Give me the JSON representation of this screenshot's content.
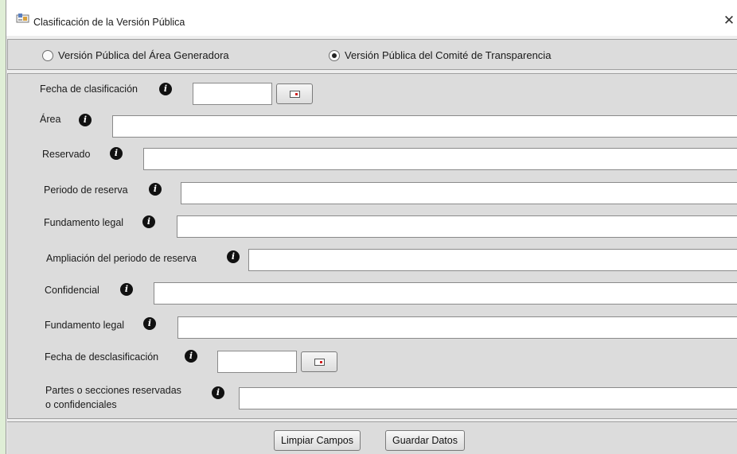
{
  "window": {
    "title": "Clasificación de la Versión Pública",
    "close_glyph": "✕",
    "app_icon": "app-icon"
  },
  "radios": [
    {
      "label": "Versión Pública del Área Generadora",
      "checked": false
    },
    {
      "label": "Versión Pública del Comité de Transparencia",
      "checked": true
    }
  ],
  "form": {
    "info_glyph": "i",
    "fecha_clasificacion": {
      "label": "Fecha de clasificación",
      "value": ""
    },
    "area": {
      "label": "Área",
      "value": ""
    },
    "reservado": {
      "label": "Reservado",
      "value": ""
    },
    "periodo_reserva": {
      "label": "Periodo de reserva",
      "value": ""
    },
    "fundamento_legal_1": {
      "label": "Fundamento legal",
      "value": ""
    },
    "ampliacion": {
      "label": "Ampliación del periodo de reserva",
      "value": ""
    },
    "confidencial": {
      "label": "Confidencial",
      "value": ""
    },
    "fundamento_legal_2": {
      "label": "Fundamento legal",
      "value": ""
    },
    "fecha_desclasificacion": {
      "label": "Fecha de desclasificación",
      "value": ""
    },
    "partes_line1": "Partes o secciones reservadas",
    "partes_line2": "o confidenciales",
    "partes_value": ""
  },
  "buttons": {
    "limpiar": "Limpiar Campos",
    "guardar": "Guardar Datos"
  }
}
